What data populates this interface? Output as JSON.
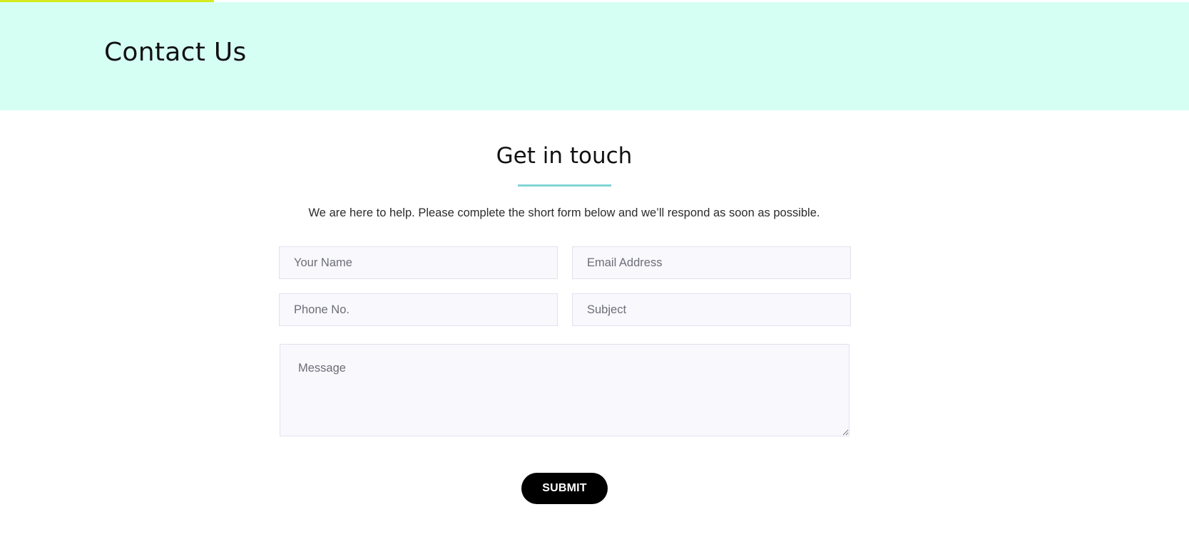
{
  "colors": {
    "hero_background": "#d6fff4",
    "progress_bar": "#d4ea1c",
    "accent_underline": "#7fd3d6",
    "button_background": "#000000",
    "button_text": "#ffffff",
    "field_background": "#f8f8fd"
  },
  "header": {
    "title": "Contact Us",
    "scroll_progress_percent": 18
  },
  "contact_section": {
    "heading": "Get in touch",
    "intro": "We are here to help. Please complete the short form below and we’ll respond as soon as possible."
  },
  "form": {
    "name": {
      "placeholder": "Your Name",
      "value": ""
    },
    "email": {
      "placeholder": "Email Address",
      "value": ""
    },
    "phone": {
      "placeholder": "Phone No.",
      "value": ""
    },
    "subject": {
      "placeholder": "Subject",
      "value": ""
    },
    "message": {
      "placeholder": "Message",
      "value": ""
    },
    "submit_label": "SUBMIT"
  }
}
